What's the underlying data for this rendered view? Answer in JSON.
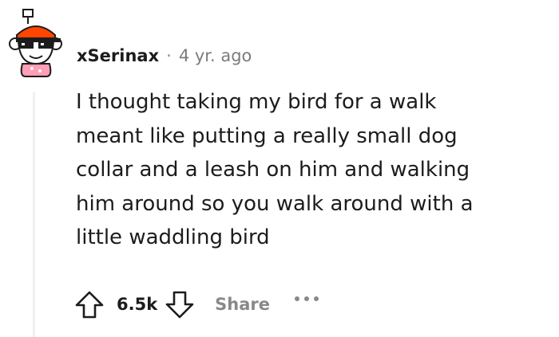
{
  "comment": {
    "username": "xSerinax",
    "separator": "·",
    "timestamp": "4 yr. ago",
    "body_lines": [
      "I thought taking my bird for a walk",
      "meant like putting a really small dog",
      "collar and a leash on him and walking",
      "him around so you walk around with a",
      "little waddling bird"
    ],
    "score": "6.5k",
    "share_label": "Share"
  },
  "icons": {
    "avatar": "snoo-avatar-with-pixel-sunglasses",
    "upvote": "upvote-arrow-icon",
    "downvote": "downvote-arrow-icon",
    "more": "more-options-icon"
  },
  "colors": {
    "text": "#1c1c1c",
    "muted": "#878a8c",
    "thread_line": "#edeff1",
    "avatar_pink": "#ff9eb6",
    "avatar_orange": "#ff4500"
  }
}
